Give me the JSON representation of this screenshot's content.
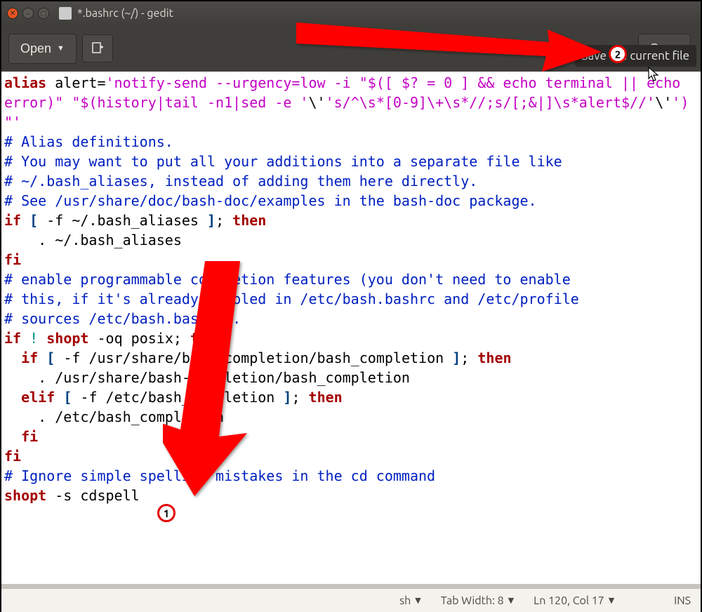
{
  "window": {
    "title": "*.bashrc (~/) - gedit"
  },
  "toolbar": {
    "open_label": "Open",
    "save_label": "Save",
    "save_tooltip": "Save the current file"
  },
  "editor_lines": [
    {
      "tokens": [
        [
          "c-red",
          "alias"
        ],
        [
          "",
          " alert="
        ],
        [
          "c-mag",
          "'notify-send --urgency=low -i \"$([ $? = 0 ] && echo terminal || echo error)\" \"$(history|tail -n1|sed -e '"
        ],
        [
          "",
          "\\'"
        ],
        [
          "c-mag",
          "'s/^\\s*[0-9]\\+\\s*//;s/[;&|]\\s*alert$//'"
        ],
        [
          "",
          "\\'"
        ],
        [
          "c-mag",
          "')\"'"
        ]
      ]
    },
    {
      "tokens": [
        [
          "",
          ""
        ]
      ]
    },
    {
      "tokens": [
        [
          "c-blue",
          "# Alias definitions."
        ]
      ]
    },
    {
      "tokens": [
        [
          "c-blue",
          "# You may want to put all your additions into a separate file like"
        ]
      ]
    },
    {
      "tokens": [
        [
          "c-blue",
          "# ~/.bash_aliases, instead of adding them here directly."
        ]
      ]
    },
    {
      "tokens": [
        [
          "c-blue",
          "# See /usr/share/doc/bash-doc/examples in the bash-doc package."
        ]
      ]
    },
    {
      "tokens": [
        [
          "",
          ""
        ]
      ]
    },
    {
      "tokens": [
        [
          "c-red",
          "if"
        ],
        [
          "",
          " "
        ],
        [
          "c-brk",
          "["
        ],
        [
          "",
          " -f ~/.bash_aliases "
        ],
        [
          "c-brk",
          "]"
        ],
        [
          "",
          "; "
        ],
        [
          "c-red",
          "then"
        ]
      ]
    },
    {
      "tokens": [
        [
          "",
          "    . ~/.bash_aliases"
        ]
      ]
    },
    {
      "tokens": [
        [
          "c-red",
          "fi"
        ]
      ]
    },
    {
      "tokens": [
        [
          "",
          ""
        ]
      ]
    },
    {
      "tokens": [
        [
          "c-blue",
          "# enable programmable completion features (you don't need to enable"
        ]
      ]
    },
    {
      "tokens": [
        [
          "c-blue",
          "# this, if it's already enabled in /etc/bash.bashrc and /etc/profile"
        ]
      ]
    },
    {
      "tokens": [
        [
          "c-blue",
          "# sources /etc/bash.bashrc)."
        ]
      ]
    },
    {
      "tokens": [
        [
          "c-red",
          "if"
        ],
        [
          "",
          " "
        ],
        [
          "c-cyan",
          "!"
        ],
        [
          "",
          " "
        ],
        [
          "c-red",
          "shopt"
        ],
        [
          "",
          " -oq posix; "
        ],
        [
          "c-red",
          "then"
        ]
      ]
    },
    {
      "tokens": [
        [
          "",
          "  "
        ],
        [
          "c-red",
          "if"
        ],
        [
          "",
          " "
        ],
        [
          "c-brk",
          "["
        ],
        [
          "",
          " -f /usr/share/bash-completion/bash_completion "
        ],
        [
          "c-brk",
          "]"
        ],
        [
          "",
          "; "
        ],
        [
          "c-red",
          "then"
        ]
      ]
    },
    {
      "tokens": [
        [
          "",
          "    . /usr/share/bash-completion/bash_completion"
        ]
      ]
    },
    {
      "tokens": [
        [
          "",
          "  "
        ],
        [
          "c-red",
          "elif"
        ],
        [
          "",
          " "
        ],
        [
          "c-brk",
          "["
        ],
        [
          "",
          " -f /etc/bash_completion "
        ],
        [
          "c-brk",
          "]"
        ],
        [
          "",
          "; "
        ],
        [
          "c-red",
          "then"
        ]
      ]
    },
    {
      "tokens": [
        [
          "",
          "    . /etc/bash_completion"
        ]
      ]
    },
    {
      "tokens": [
        [
          "",
          "  "
        ],
        [
          "c-red",
          "fi"
        ]
      ]
    },
    {
      "tokens": [
        [
          "c-red",
          "fi"
        ]
      ]
    },
    {
      "tokens": [
        [
          "",
          ""
        ]
      ]
    },
    {
      "tokens": [
        [
          "c-blue",
          "# Ignore simple spelling mistakes in the cd command"
        ]
      ]
    },
    {
      "tokens": [
        [
          "c-red",
          "shopt"
        ],
        [
          "",
          " -s cdspell"
        ]
      ]
    }
  ],
  "statusbar": {
    "syntax": "sh",
    "tab_width_label": "Tab Width: 8",
    "position": "Ln 120, Col 17",
    "insert_mode": "INS"
  },
  "annotations": {
    "badge1": "1",
    "badge2": "2"
  }
}
